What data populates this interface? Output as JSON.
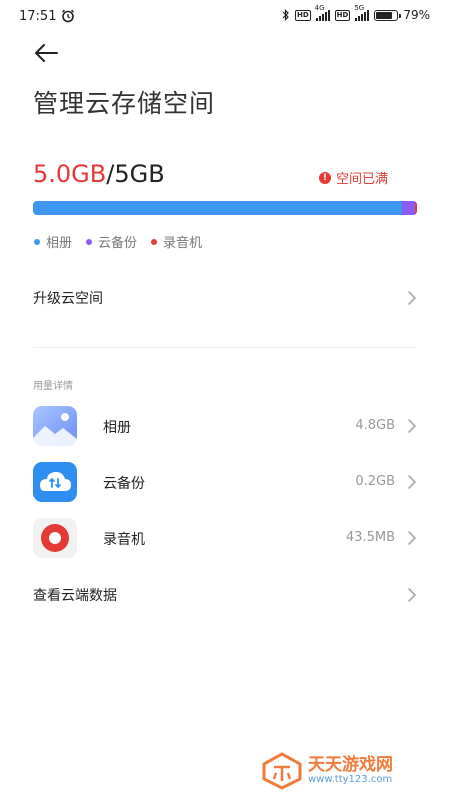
{
  "status_bar": {
    "time": "17:51",
    "hd1": "HD",
    "gen1": "4G",
    "hd2": "HD",
    "gen2": "5G",
    "battery_text": "79%",
    "battery_level": 0.79
  },
  "header": {
    "title": "管理云存储空间"
  },
  "storage": {
    "used": "5.0GB",
    "separator": "/",
    "total": "5GB",
    "full_label": "空间已满",
    "full_mark": "!",
    "segments": [
      {
        "name": "相册",
        "fraction": 0.96,
        "color": "#3d96ef"
      },
      {
        "name": "云备份",
        "fraction": 0.035,
        "color": "#8a5cf6"
      },
      {
        "name": "录音机",
        "fraction": 0.005,
        "color": "#e53935"
      }
    ]
  },
  "legend": [
    {
      "label": "相册",
      "color": "#3d96ef"
    },
    {
      "label": "云备份",
      "color": "#8a5cf6"
    },
    {
      "label": "录音机",
      "color": "#e53935"
    }
  ],
  "upgrade": {
    "label": "升级云空间"
  },
  "details": {
    "section_label": "用量详情",
    "items": [
      {
        "label": "相册",
        "size": "4.8GB",
        "icon": "gallery-icon"
      },
      {
        "label": "云备份",
        "size": "0.2GB",
        "icon": "cloud-backup-icon"
      },
      {
        "label": "录音机",
        "size": "43.5MB",
        "icon": "recorder-icon"
      }
    ]
  },
  "cloud_data": {
    "label": "查看云端数据"
  },
  "watermark": {
    "text": "天天游戏网",
    "url": "www.tty123.com"
  }
}
